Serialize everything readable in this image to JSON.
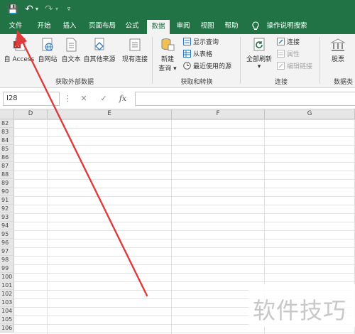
{
  "qat": {
    "save_label": "💾",
    "undo_label": "↶",
    "undo_drop": "▾",
    "redo_label": "↷",
    "redo_drop": "▾",
    "customize_label": "▿"
  },
  "tabs": [
    {
      "label": "文件"
    },
    {
      "label": "开始"
    },
    {
      "label": "插入"
    },
    {
      "label": "页面布局"
    },
    {
      "label": "公式"
    },
    {
      "label": "数据"
    },
    {
      "label": "审阅"
    },
    {
      "label": "视图"
    },
    {
      "label": "帮助"
    },
    {
      "label": "操作说明搜索"
    }
  ],
  "ribbon": {
    "get_external": {
      "access": "自 Access",
      "web": "自网站",
      "text": "自文本",
      "other": "自其他来源",
      "existing": "现有连接",
      "group_label": "获取外部数据"
    },
    "get_transform": {
      "new_query": "新建",
      "new_query_2": "查询 ▾",
      "show_queries": "显示查询",
      "from_table": "从表格",
      "recent_sources": "最近使用的源",
      "group_label": "获取和转换"
    },
    "connections": {
      "refresh_all": "全部刷新",
      "refresh_drop": "▾",
      "connections": "连接",
      "properties": "属性",
      "edit_links": "编辑链接",
      "group_label": "连接"
    },
    "data_types": {
      "stocks": "股票",
      "group_label": "数据类"
    }
  },
  "formula_bar": {
    "name_box": "I28",
    "more": "⋮",
    "cancel": "✕",
    "enter": "✓",
    "fx": "fx",
    "value": ""
  },
  "columns": [
    "D",
    "E",
    "F",
    "G"
  ],
  "rows": [
    "82",
    "83",
    "84",
    "85",
    "86",
    "87",
    "88",
    "89",
    "90",
    "91",
    "92",
    "93",
    "94",
    "95",
    "96",
    "97",
    "98",
    "99",
    "100",
    "101",
    "102",
    "103",
    "104",
    "105",
    "106"
  ],
  "watermark": "软件技巧",
  "colors": {
    "accent": "#217346",
    "arrow": "#e03b3b"
  }
}
